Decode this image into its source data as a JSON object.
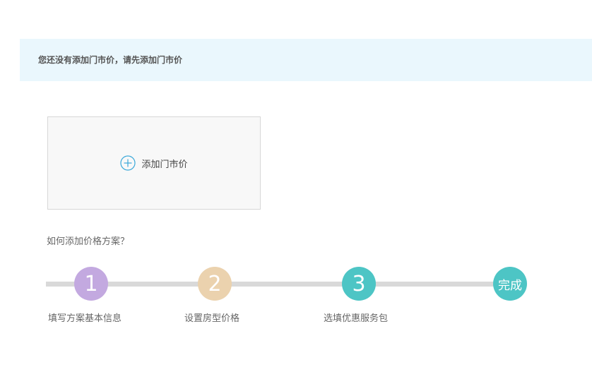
{
  "notice": {
    "text": "您还没有添加门市价，请先添加门市价"
  },
  "add_box": {
    "icon": "plus-circle-icon",
    "label": "添加门市价",
    "accent": "#3aa8d9"
  },
  "guide": {
    "title": "如何添加价格方案？"
  },
  "steps": [
    {
      "number": "1",
      "label": "填写方案基本信息",
      "color": "#c3a9e0"
    },
    {
      "number": "2",
      "label": "设置房型价格",
      "color": "#ebd2ae"
    },
    {
      "number": "3",
      "label": "选填优惠服务包",
      "color": "#4dc5c5"
    },
    {
      "number": "完成",
      "label": "",
      "color": "#4dc5c5"
    }
  ]
}
